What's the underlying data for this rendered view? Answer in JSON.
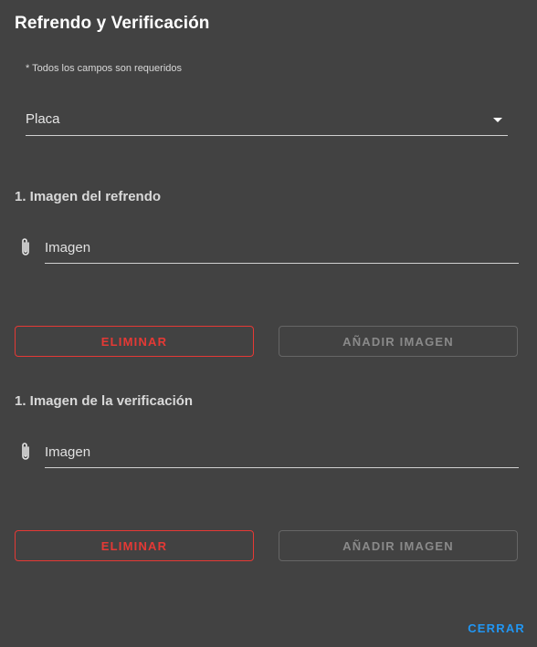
{
  "dialog": {
    "title": "Refrendo y Verificación",
    "required_note": "* Todos los campos son requeridos",
    "select": {
      "label": "Placa"
    },
    "sections": [
      {
        "heading": "1. Imagen del refrendo",
        "file_placeholder": "Imagen",
        "delete_label": "ELIMINAR",
        "add_label": "AÑADIR IMAGEN"
      },
      {
        "heading": "1. Imagen de la verificación",
        "file_placeholder": "Imagen",
        "delete_label": "ELIMINAR",
        "add_label": "AÑADIR IMAGEN"
      }
    ],
    "close_label": "CERRAR"
  },
  "colors": {
    "background": "#424242",
    "danger": "#e53935",
    "accent": "#2196f3",
    "disabled": "#8a8a8a"
  },
  "icons": {
    "attach": "paperclip-icon",
    "dropdown": "arrow-drop-down-icon"
  }
}
